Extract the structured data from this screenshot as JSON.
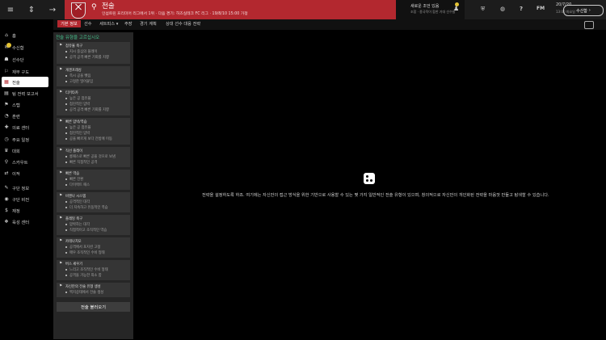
{
  "nav": {
    "menu_icon": "menu-icon",
    "forward_icon": "arrow-right-icon"
  },
  "header": {
    "club_name": "전술",
    "club_sub": "인섬트린 프리미어 리그에서 1위 · 다음 경기: 허즈실테크 FC 리그 · 19/8/10 15:00 가정"
  },
  "notification": {
    "title": "새로운 조언 있음",
    "sub": "조합 · 종국적이 합한 기대 선수들"
  },
  "topbar": {
    "date": "20/7/20",
    "time": "13:00 화요일",
    "continue_label": "수신함",
    "fm_label": "FM",
    "help_label": "?"
  },
  "tabs": [
    {
      "label": "기본 정보",
      "active": true
    },
    {
      "label": "선수"
    },
    {
      "label": "세트피스 ▾"
    },
    {
      "label": "주장"
    },
    {
      "label": "경기 계획"
    },
    {
      "label": "상대 선수 대응 전략"
    }
  ],
  "sidebar": {
    "items": [
      {
        "icon": "⌂",
        "label": "홈"
      },
      {
        "icon": "✉",
        "label": "수신함"
      },
      {
        "icon": "☗",
        "label": "선수단"
      },
      {
        "icon": "⚐",
        "label": "재무 구도"
      },
      {
        "icon": "▦",
        "label": "전술",
        "active": true
      },
      {
        "icon": "▤",
        "label": "팀 전력 보고서"
      },
      {
        "icon": "⚑",
        "label": "스텝"
      },
      {
        "icon": "◔",
        "label": "훈련"
      },
      {
        "icon": "✚",
        "label": "의료 센터"
      },
      {
        "icon": "◷",
        "label": "주요 일정"
      },
      {
        "icon": "♛",
        "label": "대회"
      },
      {
        "icon": "⚲",
        "label": "스카우트"
      },
      {
        "icon": "⇄",
        "label": "이적"
      },
      {
        "icon": "✎",
        "label": "구단 정보"
      },
      {
        "icon": "◉",
        "label": "구단 비전"
      },
      {
        "icon": "$",
        "label": "재정"
      },
      {
        "icon": "❖",
        "label": "육성 센터"
      }
    ]
  },
  "panel": {
    "title": "전술 유형을 고르십시오",
    "cards": [
      {
        "icon": "⚑",
        "title": "점유율 축구",
        "lines": [
          "지시 중심의 플레이",
          "공격 공격 빠른 기회를 지향"
        ]
      },
      {
        "icon": "⚑",
        "title": "게겐프레싱",
        "lines": [
          "즉시 공을 뺏음",
          "고정한 밀어붙임"
        ]
      },
      {
        "icon": "⚑",
        "title": "티키타카",
        "lines": [
          "높은 공 점유율",
          "점진적인 압박",
          "공격 공격 빠른 기회를 지향"
        ]
      },
      {
        "icon": "⚑",
        "title": "빠른 압박/역습",
        "lines": [
          "높은 공 점유율",
          "점진적인 압박",
          "공을 빠르게 보다 전방에 이동"
        ]
      },
      {
        "icon": "⚑",
        "title": "직선 플레이",
        "lines": [
          "롱패스로 빠른 공을 것으로 보냄",
          "빠른 직접적인 공격"
        ]
      },
      {
        "icon": "⚑",
        "title": "빠른 역습",
        "lines": [
          "빠른 전환",
          "다이렉트 패스"
        ]
      },
      {
        "icon": "⚑",
        "title": "비엔나 시스템",
        "lines": [
          "공격적인 대각",
          "더 지속하고 유동적인 역습"
        ]
      },
      {
        "icon": "⚑",
        "title": "플레잉 축구",
        "lines": [
          "압박하는 대각",
          "직접적이고 조직적인 역습"
        ]
      },
      {
        "icon": "⚑",
        "title": "카테나치오",
        "lines": [
          "공격에서 포지션 고정",
          "매우 조직적인 수비 형태"
        ]
      },
      {
        "icon": "⚑",
        "title": "버스 세우기",
        "lines": [
          "느리고 조직적인 수비 형태",
          "공격을 가능한 최소 함"
        ]
      },
      {
        "icon": "⚑",
        "title": "자신만의 전술 유형 생성",
        "lines": [
          "백지상태에서 전술 생성"
        ]
      }
    ],
    "load_label": "전술 불러오기"
  },
  "main": {
    "icon": "tactic-board-icon",
    "text": "전략을 설정하도록 하죠. 여기에는 자신만의 접근 방식을 위한 기반으로 사용할 수 있는 몇 가지 일반적인 전술 유형이 있으며, 창의적으로 자신만의 개인화된 전략을 마음껏 만들고 탐색할 수 있습니다."
  }
}
